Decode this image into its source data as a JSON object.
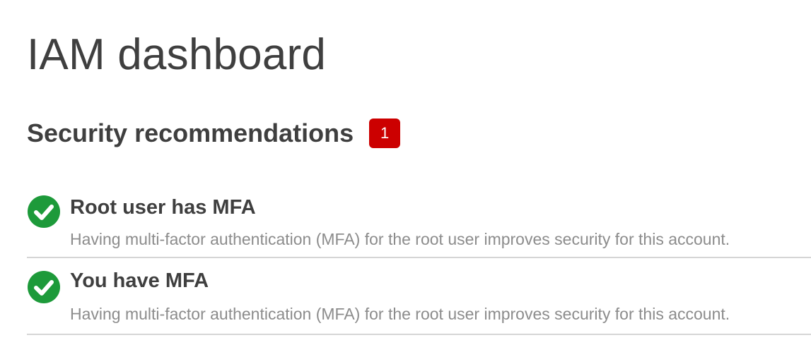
{
  "page": {
    "title": "IAM dashboard"
  },
  "security": {
    "heading": "Security recommendations",
    "badge_count": "1",
    "badge_color": "#cc0000",
    "items": [
      {
        "title": "Root user has MFA",
        "description": "Having multi-factor authentication (MFA) for the root user improves security for this account.",
        "status": "passed",
        "icon": "check-circle-icon",
        "status_color": "#1d8102"
      },
      {
        "title": "You have MFA",
        "description": "Having multi-factor authentication (MFA) for the root user improves security for this account.",
        "status": "passed",
        "icon": "check-circle-icon",
        "status_color": "#1d8102"
      }
    ]
  }
}
